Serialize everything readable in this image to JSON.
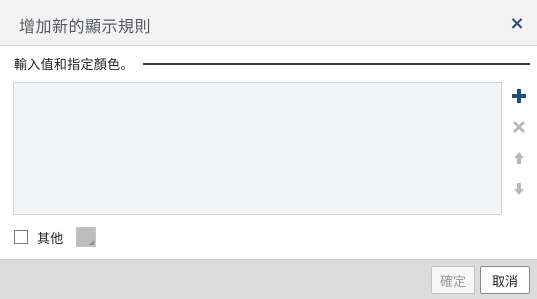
{
  "dialog": {
    "title": "增加新的顯示規則",
    "close_label": "×"
  },
  "instruction": "輸入值和指定顏色。",
  "tools": {
    "add": "plus-icon",
    "delete": "delete-x-icon",
    "move_up": "arrow-up-icon",
    "move_down": "arrow-down-icon"
  },
  "other": {
    "label": "其他",
    "checked": false,
    "swatch_color": "#bdbdbd"
  },
  "footer": {
    "ok_label": "確定",
    "cancel_label": "取消"
  },
  "colors": {
    "accent": "#1f4e7a",
    "disabled_icon": "#b8b8b8"
  }
}
